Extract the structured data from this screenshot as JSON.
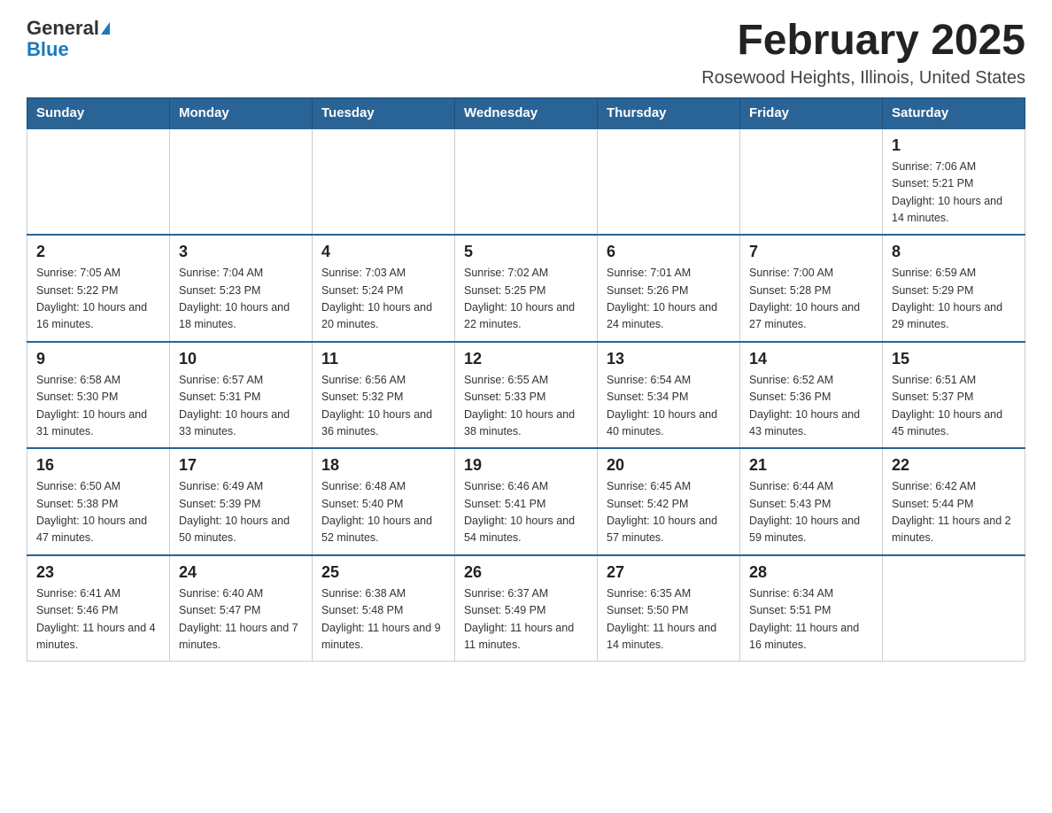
{
  "logo": {
    "general": "General",
    "blue": "Blue"
  },
  "title": "February 2025",
  "location": "Rosewood Heights, Illinois, United States",
  "days_of_week": [
    "Sunday",
    "Monday",
    "Tuesday",
    "Wednesday",
    "Thursday",
    "Friday",
    "Saturday"
  ],
  "weeks": [
    [
      {
        "day": "",
        "sunrise": "",
        "sunset": "",
        "daylight": ""
      },
      {
        "day": "",
        "sunrise": "",
        "sunset": "",
        "daylight": ""
      },
      {
        "day": "",
        "sunrise": "",
        "sunset": "",
        "daylight": ""
      },
      {
        "day": "",
        "sunrise": "",
        "sunset": "",
        "daylight": ""
      },
      {
        "day": "",
        "sunrise": "",
        "sunset": "",
        "daylight": ""
      },
      {
        "day": "",
        "sunrise": "",
        "sunset": "",
        "daylight": ""
      },
      {
        "day": "1",
        "sunrise": "Sunrise: 7:06 AM",
        "sunset": "Sunset: 5:21 PM",
        "daylight": "Daylight: 10 hours and 14 minutes."
      }
    ],
    [
      {
        "day": "2",
        "sunrise": "Sunrise: 7:05 AM",
        "sunset": "Sunset: 5:22 PM",
        "daylight": "Daylight: 10 hours and 16 minutes."
      },
      {
        "day": "3",
        "sunrise": "Sunrise: 7:04 AM",
        "sunset": "Sunset: 5:23 PM",
        "daylight": "Daylight: 10 hours and 18 minutes."
      },
      {
        "day": "4",
        "sunrise": "Sunrise: 7:03 AM",
        "sunset": "Sunset: 5:24 PM",
        "daylight": "Daylight: 10 hours and 20 minutes."
      },
      {
        "day": "5",
        "sunrise": "Sunrise: 7:02 AM",
        "sunset": "Sunset: 5:25 PM",
        "daylight": "Daylight: 10 hours and 22 minutes."
      },
      {
        "day": "6",
        "sunrise": "Sunrise: 7:01 AM",
        "sunset": "Sunset: 5:26 PM",
        "daylight": "Daylight: 10 hours and 24 minutes."
      },
      {
        "day": "7",
        "sunrise": "Sunrise: 7:00 AM",
        "sunset": "Sunset: 5:28 PM",
        "daylight": "Daylight: 10 hours and 27 minutes."
      },
      {
        "day": "8",
        "sunrise": "Sunrise: 6:59 AM",
        "sunset": "Sunset: 5:29 PM",
        "daylight": "Daylight: 10 hours and 29 minutes."
      }
    ],
    [
      {
        "day": "9",
        "sunrise": "Sunrise: 6:58 AM",
        "sunset": "Sunset: 5:30 PM",
        "daylight": "Daylight: 10 hours and 31 minutes."
      },
      {
        "day": "10",
        "sunrise": "Sunrise: 6:57 AM",
        "sunset": "Sunset: 5:31 PM",
        "daylight": "Daylight: 10 hours and 33 minutes."
      },
      {
        "day": "11",
        "sunrise": "Sunrise: 6:56 AM",
        "sunset": "Sunset: 5:32 PM",
        "daylight": "Daylight: 10 hours and 36 minutes."
      },
      {
        "day": "12",
        "sunrise": "Sunrise: 6:55 AM",
        "sunset": "Sunset: 5:33 PM",
        "daylight": "Daylight: 10 hours and 38 minutes."
      },
      {
        "day": "13",
        "sunrise": "Sunrise: 6:54 AM",
        "sunset": "Sunset: 5:34 PM",
        "daylight": "Daylight: 10 hours and 40 minutes."
      },
      {
        "day": "14",
        "sunrise": "Sunrise: 6:52 AM",
        "sunset": "Sunset: 5:36 PM",
        "daylight": "Daylight: 10 hours and 43 minutes."
      },
      {
        "day": "15",
        "sunrise": "Sunrise: 6:51 AM",
        "sunset": "Sunset: 5:37 PM",
        "daylight": "Daylight: 10 hours and 45 minutes."
      }
    ],
    [
      {
        "day": "16",
        "sunrise": "Sunrise: 6:50 AM",
        "sunset": "Sunset: 5:38 PM",
        "daylight": "Daylight: 10 hours and 47 minutes."
      },
      {
        "day": "17",
        "sunrise": "Sunrise: 6:49 AM",
        "sunset": "Sunset: 5:39 PM",
        "daylight": "Daylight: 10 hours and 50 minutes."
      },
      {
        "day": "18",
        "sunrise": "Sunrise: 6:48 AM",
        "sunset": "Sunset: 5:40 PM",
        "daylight": "Daylight: 10 hours and 52 minutes."
      },
      {
        "day": "19",
        "sunrise": "Sunrise: 6:46 AM",
        "sunset": "Sunset: 5:41 PM",
        "daylight": "Daylight: 10 hours and 54 minutes."
      },
      {
        "day": "20",
        "sunrise": "Sunrise: 6:45 AM",
        "sunset": "Sunset: 5:42 PM",
        "daylight": "Daylight: 10 hours and 57 minutes."
      },
      {
        "day": "21",
        "sunrise": "Sunrise: 6:44 AM",
        "sunset": "Sunset: 5:43 PM",
        "daylight": "Daylight: 10 hours and 59 minutes."
      },
      {
        "day": "22",
        "sunrise": "Sunrise: 6:42 AM",
        "sunset": "Sunset: 5:44 PM",
        "daylight": "Daylight: 11 hours and 2 minutes."
      }
    ],
    [
      {
        "day": "23",
        "sunrise": "Sunrise: 6:41 AM",
        "sunset": "Sunset: 5:46 PM",
        "daylight": "Daylight: 11 hours and 4 minutes."
      },
      {
        "day": "24",
        "sunrise": "Sunrise: 6:40 AM",
        "sunset": "Sunset: 5:47 PM",
        "daylight": "Daylight: 11 hours and 7 minutes."
      },
      {
        "day": "25",
        "sunrise": "Sunrise: 6:38 AM",
        "sunset": "Sunset: 5:48 PM",
        "daylight": "Daylight: 11 hours and 9 minutes."
      },
      {
        "day": "26",
        "sunrise": "Sunrise: 6:37 AM",
        "sunset": "Sunset: 5:49 PM",
        "daylight": "Daylight: 11 hours and 11 minutes."
      },
      {
        "day": "27",
        "sunrise": "Sunrise: 6:35 AM",
        "sunset": "Sunset: 5:50 PM",
        "daylight": "Daylight: 11 hours and 14 minutes."
      },
      {
        "day": "28",
        "sunrise": "Sunrise: 6:34 AM",
        "sunset": "Sunset: 5:51 PM",
        "daylight": "Daylight: 11 hours and 16 minutes."
      },
      {
        "day": "",
        "sunrise": "",
        "sunset": "",
        "daylight": ""
      }
    ]
  ]
}
